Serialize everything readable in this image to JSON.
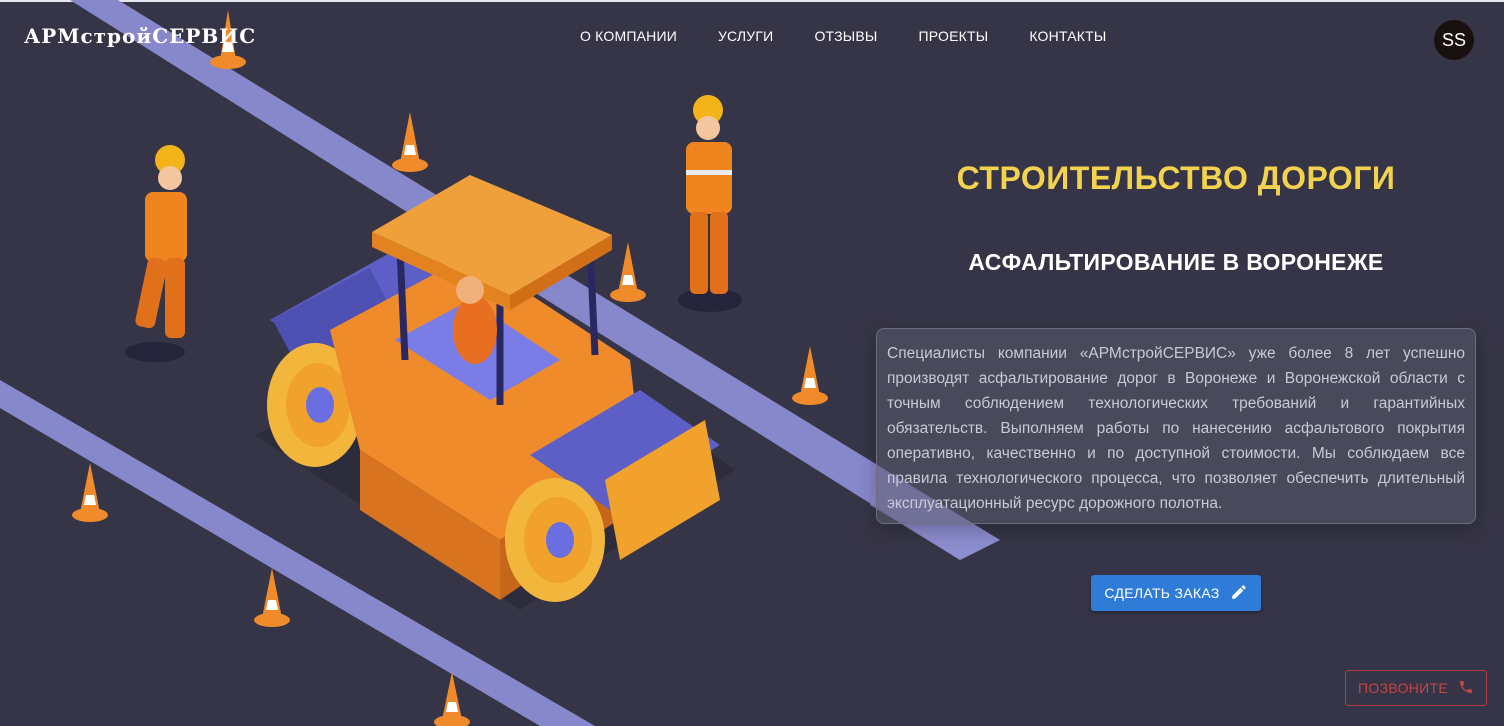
{
  "brand": {
    "name": "АРМстройСЕРВИС"
  },
  "nav": {
    "items": [
      {
        "label": "О КОМПАНИИ"
      },
      {
        "label": "УСЛУГИ"
      },
      {
        "label": "ОТЗЫВЫ"
      },
      {
        "label": "ПРОЕКТЫ"
      },
      {
        "label": "КОНТАКТЫ"
      }
    ]
  },
  "user": {
    "initials": "SS"
  },
  "hero": {
    "title": "СТРОИТЕЛЬСТВО ДОРОГИ",
    "subtitle": "АСФАЛЬТИРОВАНИЕ В ВОРОНЕЖЕ",
    "description": "Специалисты компании «АРМстройСЕРВИС» уже более 8 лет успешно производят асфальтирование дорог в Воронеже и Воронежской области с точным соблюдением технологических требований и гарантийных обязательств. Выполняем работы по нанесению асфальтового покрытия оперативно, качественно и по доступной стоимости. Мы соблюдаем все правила технологического процесса, что позволяет обеспечить длительный эксплуатационный ресурс дорожного полотна."
  },
  "actions": {
    "order_label": "СДЕЛАТЬ ЗАКАЗ",
    "order_icon": "pencil-icon",
    "call_label": "ПОЗВОНИТЕ",
    "call_icon": "phone-icon"
  },
  "colors": {
    "background": "#363547",
    "title": "#f2d24e",
    "order_button": "#2f7bd8",
    "call_button": "#c24545"
  }
}
